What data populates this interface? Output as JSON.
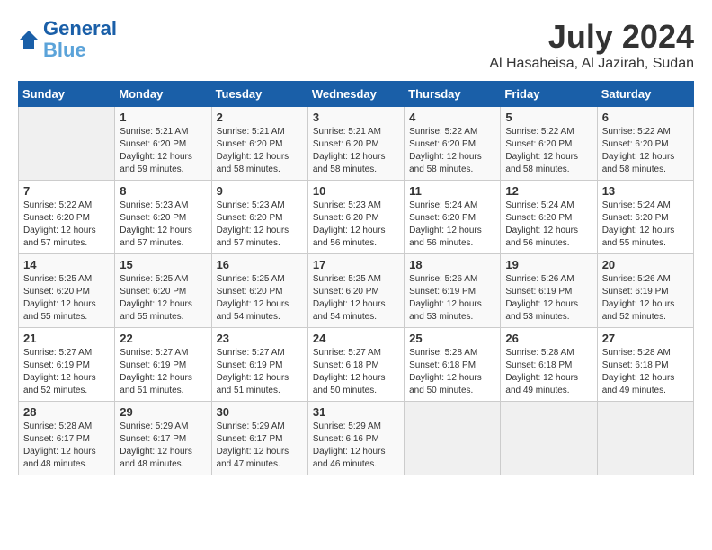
{
  "header": {
    "logo_line1": "General",
    "logo_line2": "Blue",
    "month_year": "July 2024",
    "location": "Al Hasaheisa, Al Jazirah, Sudan"
  },
  "days_of_week": [
    "Sunday",
    "Monday",
    "Tuesday",
    "Wednesday",
    "Thursday",
    "Friday",
    "Saturday"
  ],
  "weeks": [
    [
      {
        "day": "",
        "info": ""
      },
      {
        "day": "1",
        "info": "Sunrise: 5:21 AM\nSunset: 6:20 PM\nDaylight: 12 hours\nand 59 minutes."
      },
      {
        "day": "2",
        "info": "Sunrise: 5:21 AM\nSunset: 6:20 PM\nDaylight: 12 hours\nand 58 minutes."
      },
      {
        "day": "3",
        "info": "Sunrise: 5:21 AM\nSunset: 6:20 PM\nDaylight: 12 hours\nand 58 minutes."
      },
      {
        "day": "4",
        "info": "Sunrise: 5:22 AM\nSunset: 6:20 PM\nDaylight: 12 hours\nand 58 minutes."
      },
      {
        "day": "5",
        "info": "Sunrise: 5:22 AM\nSunset: 6:20 PM\nDaylight: 12 hours\nand 58 minutes."
      },
      {
        "day": "6",
        "info": "Sunrise: 5:22 AM\nSunset: 6:20 PM\nDaylight: 12 hours\nand 58 minutes."
      }
    ],
    [
      {
        "day": "7",
        "info": "Sunrise: 5:22 AM\nSunset: 6:20 PM\nDaylight: 12 hours\nand 57 minutes."
      },
      {
        "day": "8",
        "info": "Sunrise: 5:23 AM\nSunset: 6:20 PM\nDaylight: 12 hours\nand 57 minutes."
      },
      {
        "day": "9",
        "info": "Sunrise: 5:23 AM\nSunset: 6:20 PM\nDaylight: 12 hours\nand 57 minutes."
      },
      {
        "day": "10",
        "info": "Sunrise: 5:23 AM\nSunset: 6:20 PM\nDaylight: 12 hours\nand 56 minutes."
      },
      {
        "day": "11",
        "info": "Sunrise: 5:24 AM\nSunset: 6:20 PM\nDaylight: 12 hours\nand 56 minutes."
      },
      {
        "day": "12",
        "info": "Sunrise: 5:24 AM\nSunset: 6:20 PM\nDaylight: 12 hours\nand 56 minutes."
      },
      {
        "day": "13",
        "info": "Sunrise: 5:24 AM\nSunset: 6:20 PM\nDaylight: 12 hours\nand 55 minutes."
      }
    ],
    [
      {
        "day": "14",
        "info": "Sunrise: 5:25 AM\nSunset: 6:20 PM\nDaylight: 12 hours\nand 55 minutes."
      },
      {
        "day": "15",
        "info": "Sunrise: 5:25 AM\nSunset: 6:20 PM\nDaylight: 12 hours\nand 55 minutes."
      },
      {
        "day": "16",
        "info": "Sunrise: 5:25 AM\nSunset: 6:20 PM\nDaylight: 12 hours\nand 54 minutes."
      },
      {
        "day": "17",
        "info": "Sunrise: 5:25 AM\nSunset: 6:20 PM\nDaylight: 12 hours\nand 54 minutes."
      },
      {
        "day": "18",
        "info": "Sunrise: 5:26 AM\nSunset: 6:19 PM\nDaylight: 12 hours\nand 53 minutes."
      },
      {
        "day": "19",
        "info": "Sunrise: 5:26 AM\nSunset: 6:19 PM\nDaylight: 12 hours\nand 53 minutes."
      },
      {
        "day": "20",
        "info": "Sunrise: 5:26 AM\nSunset: 6:19 PM\nDaylight: 12 hours\nand 52 minutes."
      }
    ],
    [
      {
        "day": "21",
        "info": "Sunrise: 5:27 AM\nSunset: 6:19 PM\nDaylight: 12 hours\nand 52 minutes."
      },
      {
        "day": "22",
        "info": "Sunrise: 5:27 AM\nSunset: 6:19 PM\nDaylight: 12 hours\nand 51 minutes."
      },
      {
        "day": "23",
        "info": "Sunrise: 5:27 AM\nSunset: 6:19 PM\nDaylight: 12 hours\nand 51 minutes."
      },
      {
        "day": "24",
        "info": "Sunrise: 5:27 AM\nSunset: 6:18 PM\nDaylight: 12 hours\nand 50 minutes."
      },
      {
        "day": "25",
        "info": "Sunrise: 5:28 AM\nSunset: 6:18 PM\nDaylight: 12 hours\nand 50 minutes."
      },
      {
        "day": "26",
        "info": "Sunrise: 5:28 AM\nSunset: 6:18 PM\nDaylight: 12 hours\nand 49 minutes."
      },
      {
        "day": "27",
        "info": "Sunrise: 5:28 AM\nSunset: 6:18 PM\nDaylight: 12 hours\nand 49 minutes."
      }
    ],
    [
      {
        "day": "28",
        "info": "Sunrise: 5:28 AM\nSunset: 6:17 PM\nDaylight: 12 hours\nand 48 minutes."
      },
      {
        "day": "29",
        "info": "Sunrise: 5:29 AM\nSunset: 6:17 PM\nDaylight: 12 hours\nand 48 minutes."
      },
      {
        "day": "30",
        "info": "Sunrise: 5:29 AM\nSunset: 6:17 PM\nDaylight: 12 hours\nand 47 minutes."
      },
      {
        "day": "31",
        "info": "Sunrise: 5:29 AM\nSunset: 6:16 PM\nDaylight: 12 hours\nand 46 minutes."
      },
      {
        "day": "",
        "info": ""
      },
      {
        "day": "",
        "info": ""
      },
      {
        "day": "",
        "info": ""
      }
    ]
  ]
}
